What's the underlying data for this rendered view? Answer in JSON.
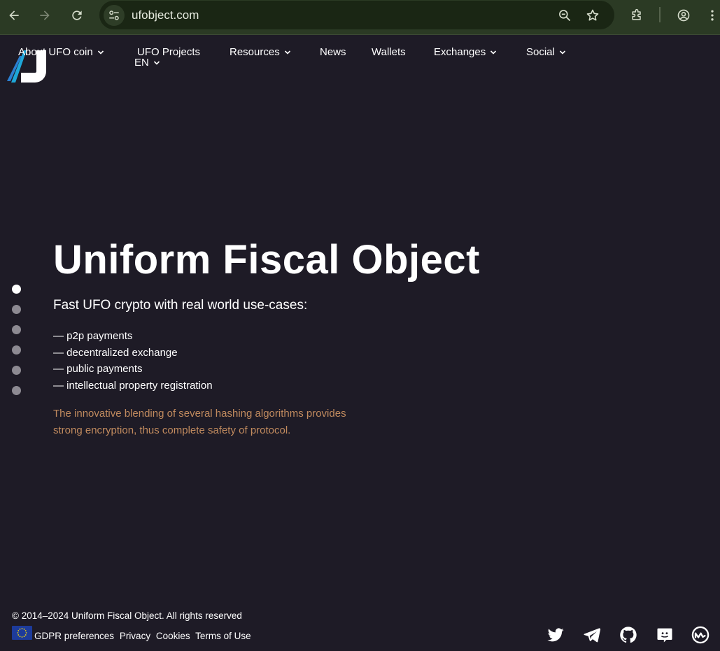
{
  "browser": {
    "url": "ufobject.com",
    "back_icon": "arrow-left-icon",
    "forward_icon": "arrow-right-icon",
    "reload_icon": "reload-icon",
    "site_info_icon": "tune-icon",
    "zoom_icon": "zoom-out-icon",
    "bookmark_icon": "star-icon",
    "extensions_icon": "puzzle-icon",
    "profile_icon": "account-icon",
    "menu_icon": "kebab-menu-icon"
  },
  "nav": {
    "items": [
      {
        "label": "About UFO coin",
        "dropdown": true
      },
      {
        "label": "UFO Projects",
        "dropdown": false
      },
      {
        "label": "Resources",
        "dropdown": true
      },
      {
        "label": "News",
        "dropdown": false
      },
      {
        "label": "Wallets",
        "dropdown": false
      },
      {
        "label": "Exchanges",
        "dropdown": true
      },
      {
        "label": "Social",
        "dropdown": true
      }
    ],
    "language": "EN"
  },
  "pager": {
    "count": 6,
    "active": 0
  },
  "hero": {
    "title": "Uniform Fiscal Object",
    "subtitle": "Fast UFO crypto with real world use-cases:",
    "list": [
      "— p2p payments",
      "— decentralized exchange",
      "— public payments",
      "— intellectual property registration"
    ],
    "description": "The innovative blending of several hashing algorithms provides strong encryption, thus complete safety of protocol."
  },
  "footer": {
    "copyright": "© 2014–2024 Uniform Fiscal Object. All rights reserved",
    "links": [
      "GDPR preferences",
      "Privacy",
      "Cookies",
      "Terms of Use"
    ],
    "social_icons": [
      "twitter-icon",
      "telegram-icon",
      "github-icon",
      "discord-icon",
      "coinmarketcap-icon"
    ]
  },
  "colors": {
    "background": "#1e1b26",
    "browser_bar": "#2b3a24",
    "accent_text": "#c08a5e",
    "dot_inactive": "#8d8a92"
  }
}
